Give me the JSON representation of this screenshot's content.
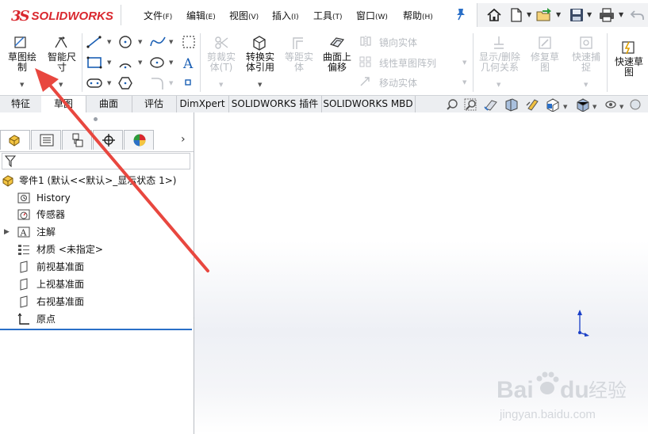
{
  "app": {
    "brand_ds": "3S",
    "brand_name": "SOLIDWORKS"
  },
  "menu": {
    "items": [
      {
        "label": "文件",
        "key": "(F)"
      },
      {
        "label": "编辑",
        "key": "(E)"
      },
      {
        "label": "视图",
        "key": "(V)"
      },
      {
        "label": "插入",
        "key": "(I)"
      },
      {
        "label": "工具",
        "key": "(T)"
      },
      {
        "label": "窗口",
        "key": "(W)"
      },
      {
        "label": "帮助",
        "key": "(H)"
      }
    ]
  },
  "quick_access": [
    "home-icon",
    "new-document-icon",
    "open-folder-icon",
    "save-icon",
    "print-icon",
    "undo-icon"
  ],
  "commands": {
    "sketch": {
      "label_line1": "草图绘",
      "label_line2": "制"
    },
    "smart_dim": {
      "label_line1": "智能尺",
      "label_line2": "寸"
    },
    "trim": {
      "label_line1": "剪裁实",
      "label_line2": "体(T)"
    },
    "convert": {
      "label_line1": "转换实",
      "label_line2": "体引用"
    },
    "offset": {
      "label_line1": "等距实",
      "label_line2": "体"
    },
    "surface_offset": {
      "label_line1": "曲面上",
      "label_line2": "偏移"
    },
    "mirror": "镜向实体",
    "linear_pattern": "线性草图阵列",
    "move": "移动实体",
    "show_relations": {
      "label_line1": "显示/删除",
      "label_line2": "几何关系"
    },
    "repair": {
      "label_line1": "修复草",
      "label_line2": "图"
    },
    "quick_snaps": {
      "label_line1": "快速捕",
      "label_line2": "捉"
    },
    "rapid_sketch": {
      "label_line1": "快速草",
      "label_line2": "图"
    }
  },
  "tabs": [
    "特征",
    "草图",
    "曲面",
    "评估",
    "DimXpert",
    "SOLIDWORKS 插件",
    "SOLIDWORKS MBD"
  ],
  "active_tab": "草图",
  "tree": {
    "root": "零件1  (默认<<默认>_显示状态 1>)",
    "items": [
      "History",
      "传感器",
      "注解",
      "材质 <未指定>",
      "前视基准面",
      "上视基准面",
      "右视基准面",
      "原点"
    ]
  },
  "watermark": {
    "brand": "Bai",
    "brand_tail": "du",
    "cn": "经验",
    "url": "jingyan.baidu.com"
  },
  "colors": {
    "brand_red": "#d9272e",
    "arrow_red": "#e8473f",
    "rollback_blue": "#2a6fc7",
    "accent_blue": "#1a5fb4"
  }
}
